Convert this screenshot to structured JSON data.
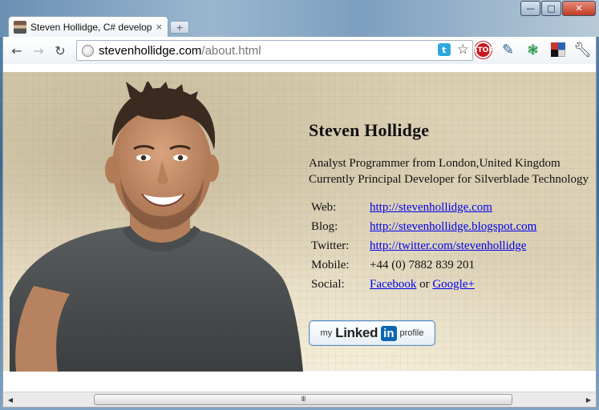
{
  "browser": {
    "tab_title": "Steven Hollidge, C# develop",
    "tab_close": "×",
    "new_tab": "+",
    "url_host": "stevenhollidge.com",
    "url_path": "/about.html",
    "controls": {
      "minimize": "—",
      "maximize": "□",
      "close": "✕"
    },
    "nav": {
      "back": "←",
      "forward": "→",
      "reload": "↻"
    },
    "twitter_icon": "t",
    "star": "☆",
    "extensions": [
      "stop-icon",
      "eyedropper-icon",
      "bug-icon",
      "blocks-icon",
      "wrench-icon"
    ],
    "ext_stop_label": "STOP"
  },
  "profile": {
    "name": "Steven Hollidge",
    "bio_line1": "Analyst Programmer from London,United Kingdom",
    "bio_line2": "Currently Principal Developer for Silverblade Technology",
    "rows": {
      "web_key": "Web:",
      "web_val": "http://stevenhollidge.com",
      "blog_key": "Blog:",
      "blog_val": "http://stevenhollidge.blogspot.com",
      "twitter_key": "Twitter:",
      "twitter_val": "http://twitter.com/stevenhollidge",
      "mobile_key": "Mobile:",
      "mobile_val": "+44 (0) 7882 839 201",
      "social_key": "Social:",
      "social_facebook": "Facebook",
      "social_or": "or",
      "social_google": "Google+"
    },
    "linkedin": {
      "my": "my",
      "linked": "Linked",
      "in": "in",
      "profile": "profile"
    }
  },
  "scrollbar": {
    "left_arrow": "◀",
    "right_arrow": "▶",
    "grip": "III"
  },
  "colors": {
    "link": "#0000ee",
    "paper": "#e6dcc2",
    "chrome_frame": "#5f86ad"
  }
}
